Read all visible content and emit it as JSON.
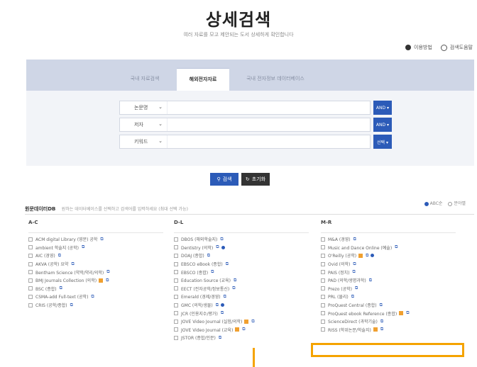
{
  "title": "상세검색",
  "subtitle": "여러 자료를 모고 제안되는 도서 상세하게 확인합니다",
  "top_links": [
    {
      "label": "이용방법",
      "icon": "dot-icon"
    },
    {
      "label": "검색도움말",
      "icon": "help-circle-icon"
    }
  ],
  "tabs": [
    {
      "label": "국내 자료검색",
      "active": false
    },
    {
      "label": "해외전자자료",
      "active": true
    },
    {
      "label": "국내 전자정보 데이터베이스",
      "active": false
    }
  ],
  "search_rows": [
    {
      "field": "논문명",
      "op": "AND ▾"
    },
    {
      "field": "저자",
      "op": "AND ▾"
    },
    {
      "field": "키워드",
      "op": "선택 ▾"
    }
  ],
  "buttons": {
    "search": "검색",
    "reset": "초기화"
  },
  "db_section": {
    "heading": "원문데이터DB",
    "description": "원하는 데이터베이스를 선택하고 검색어를 입력하세요 (최대 선택 가능)",
    "view_options": [
      "ABC순",
      "분야별"
    ]
  },
  "columns": [
    {
      "header": "A-C",
      "items": [
        {
          "label": "ACM digital Library (영문) 공학"
        },
        {
          "label": "ambient 학술지 (공학)"
        },
        {
          "label": "AIC (경영)"
        },
        {
          "label": "AKVA (공학) 요약"
        },
        {
          "label": "Bentham Science (약학/약리/의학)"
        },
        {
          "label": "BMJ Journals Collection (의학)",
          "oa": true
        },
        {
          "label": "BSC (종합)"
        },
        {
          "label": "CSMA-add Full-text (공학)"
        },
        {
          "label": "CRIS (공학/종합)"
        }
      ]
    },
    {
      "header": "D-L",
      "items": [
        {
          "label": "DBOS (해외학술지)"
        },
        {
          "label": "Dentistry (의학)",
          "star": true
        },
        {
          "label": "DOAJ (종합)"
        },
        {
          "label": "EBSCO eBook (종합)"
        },
        {
          "label": "EBSCO (종합)"
        },
        {
          "label": "Education Source (교육)"
        },
        {
          "label": "EECT (전자공학/정보통신)"
        },
        {
          "label": "Emerald (경제/경영)"
        },
        {
          "label": "GMC (의학/생물)",
          "star": true
        },
        {
          "label": "JCR (인용지수/평가)"
        },
        {
          "label": "JOVE Video Journal (실험/의학)",
          "oa": true
        },
        {
          "label": "JOVE Video Journal (교육)",
          "oa": true
        },
        {
          "label": "JSTOR (종합/인문)"
        }
      ]
    },
    {
      "header": "M-R",
      "items": [
        {
          "label": "M&A (경영)"
        },
        {
          "label": "Music and Dance Online (예술)"
        },
        {
          "label": "O'Reilly (공학)",
          "oa": true,
          "star": true
        },
        {
          "label": "Ovid (의학)"
        },
        {
          "label": "PAIS (정치)"
        },
        {
          "label": "PAD (의학/생명과학)"
        },
        {
          "label": "Prezo (공학)"
        },
        {
          "label": "PRL (물리)"
        },
        {
          "label": "ProQuest Central (종합)"
        },
        {
          "label": "ProQuest ebook Reference (종합)",
          "oa": true
        },
        {
          "label": "ScienceDirect (과학기술)"
        },
        {
          "label": "RISS (학위논문/학술지)",
          "oa": true
        }
      ]
    }
  ],
  "colors": {
    "accent": "#2c5bb8",
    "highlight": "#f5a300",
    "tabbar": "#cfd6e6"
  }
}
